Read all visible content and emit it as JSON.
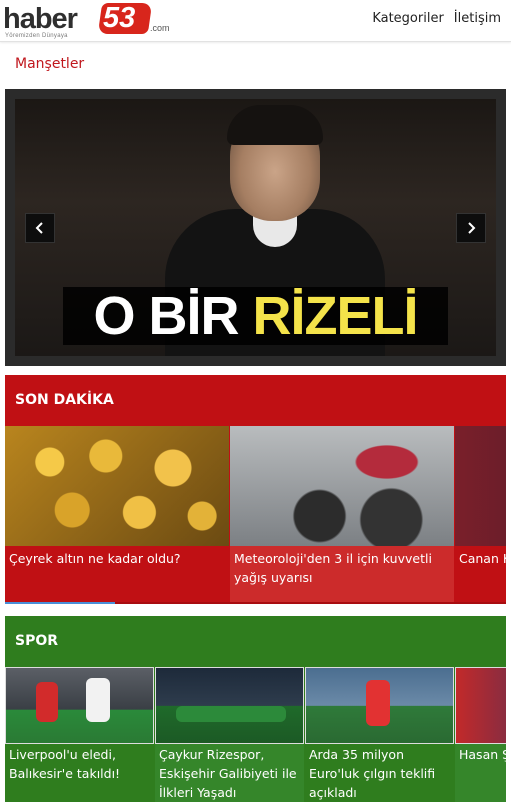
{
  "header": {
    "logo_word": "haber",
    "logo_number": "53",
    "logo_com": ".com",
    "logo_tagline": "Yöremizden Dünyaya",
    "nav": [
      "Kategoriler",
      "İletişim"
    ]
  },
  "manset": {
    "title": "Manşetler",
    "caption_white": "O BİR",
    "caption_yellow": "RİZELİ"
  },
  "son_dakika": {
    "title": "SON DAKİKA",
    "cards": [
      {
        "title": "Çeyrek altın ne kadar oldu?"
      },
      {
        "title": "Meteoroloji'den 3 il için kuvvetli yağış uyarısı"
      },
      {
        "title": "Canan K açıklama"
      }
    ],
    "progress": 0.22
  },
  "spor": {
    "title": "SPOR",
    "cards": [
      {
        "title": "Liverpool'u eledi, Balıkesir'e takıldı!"
      },
      {
        "title": "Çaykur Rizespor, Eskişehir Galibiyeti ile İlkleri Yaşadı"
      },
      {
        "title": "Arda 35 milyon Euro'luk çılgın teklifi açıkladı"
      },
      {
        "title": "Hasan Ş şampiyo"
      }
    ]
  },
  "colors": {
    "brand_red": "#c01014",
    "sport_green": "#2f7d1e",
    "caption_yellow": "#f4e34a"
  },
  "icons": [
    "chevron-left-icon",
    "chevron-right-icon"
  ]
}
